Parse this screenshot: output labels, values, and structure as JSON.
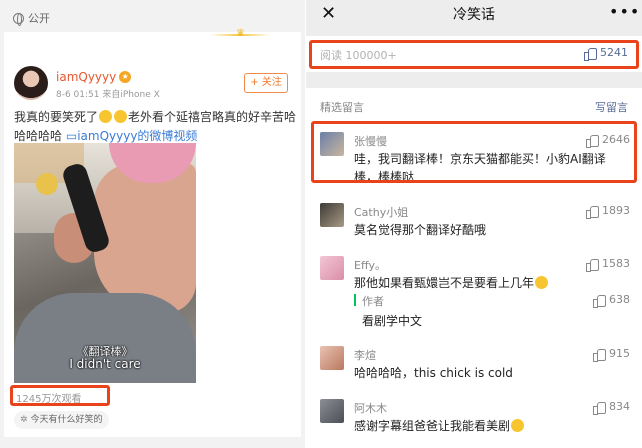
{
  "left": {
    "visibility": "公开",
    "user": {
      "name": "iamQyyyy",
      "meta": "8-6 01:51  来自iPhone X"
    },
    "follow_label": "+ 关注",
    "post": {
      "part1": "我真的要笑死了",
      "part2": "老外看个延禧宫略真的好辛苦哈哈哈哈哈",
      "link": "iamQyyyy的微博视频"
    },
    "video": {
      "sub1": "《翻译棒》",
      "sub2": "I didn't care"
    },
    "views": "1245万次观看",
    "hot_topic": "今天有什么好笑的"
  },
  "right": {
    "title": "冷笑话",
    "read": {
      "label": "阅读 100000+",
      "likes": "5241"
    },
    "section_title": "精选留言",
    "write_label": "写留言",
    "comments": [
      {
        "name": "张慢慢",
        "likes": "2646",
        "text": "哇，我司翻译棒！京东天猫都能买！小豹AI翻译棒，棒棒哒"
      },
      {
        "name": "Cathy小姐",
        "likes": "1893",
        "text": "莫名觉得那个翻译好酷哦"
      },
      {
        "name": "Effy。",
        "likes": "1583",
        "text": "那他如果看甄嬛岂不是要看上几年",
        "reply": {
          "who": "作者",
          "likes": "638",
          "text": "看剧学中文"
        }
      },
      {
        "name": "李煊",
        "likes": "915",
        "text": "哈哈哈哈，this chick is cold"
      },
      {
        "name": "阿木木",
        "likes": "834",
        "text": "感谢字幕组爸爸让我能看美剧"
      }
    ]
  },
  "colors": {
    "highlight": "#e8431b",
    "link": "#576b95",
    "weibo_orange": "#f07a2c"
  }
}
